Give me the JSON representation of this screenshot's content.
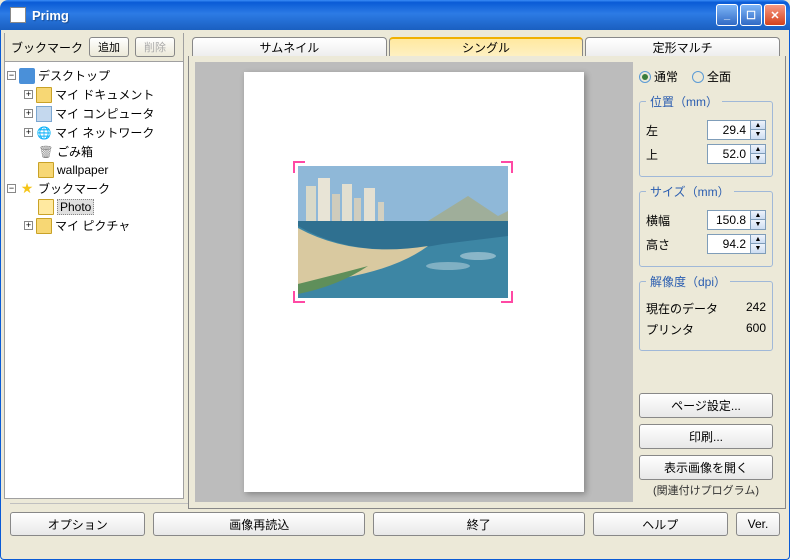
{
  "window": {
    "title": "Primg"
  },
  "left": {
    "bookmark_label": "ブックマーク",
    "add": "追加",
    "delete": "削除"
  },
  "tree": {
    "desktop": "デスクトップ",
    "mydocs": "マイ ドキュメント",
    "mycomp": "マイ コンピュータ",
    "mynet": "マイ ネットワーク",
    "trash": "ごみ箱",
    "wallpaper": "wallpaper",
    "bookmark": "ブックマーク",
    "photo": "Photo",
    "mypics": "マイ ピクチャ"
  },
  "tabs": {
    "thumb": "サムネイル",
    "single": "シングル",
    "multi": "定形マルチ"
  },
  "mode": {
    "normal": "通常",
    "full": "全面"
  },
  "pos": {
    "title": "位置（mm）",
    "left_label": "左",
    "left_value": "29.4",
    "top_label": "上",
    "top_value": "52.0"
  },
  "size": {
    "title": "サイズ（mm）",
    "w_label": "横幅",
    "w_value": "150.8",
    "h_label": "高さ",
    "h_value": "94.2"
  },
  "res": {
    "title": "解像度（dpi）",
    "current_label": "現在のデータ",
    "current_value": "242",
    "printer_label": "プリンタ",
    "printer_value": "600"
  },
  "actions": {
    "page_setup": "ページ設定...",
    "print": "印刷...",
    "open_image": "表示画像を開く",
    "open_image_sub": "(関連付けプログラム)"
  },
  "bottom": {
    "options": "オプション",
    "reload": "画像再読込",
    "exit": "終了",
    "help": "ヘルプ",
    "ver": "Ver."
  }
}
